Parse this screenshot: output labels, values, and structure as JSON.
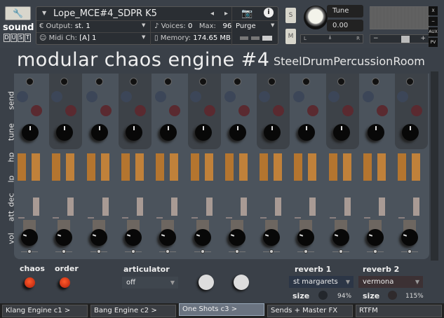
{
  "header": {
    "instrument_name": "Lope_MCE#4_SDPR K5",
    "output_label": "Output:",
    "output_value": "st. 1",
    "voices_label": "Voices:",
    "voices_value": "0",
    "max_label": "Max:",
    "max_value": "96",
    "purge_label": "Purge",
    "midi_label": "Midi Ch:",
    "midi_value": "[A] 1",
    "memory_label": "Memory:",
    "memory_value": "174.65 MB",
    "solo_label": "S",
    "mute_label": "M",
    "tune_label": "Tune",
    "tune_value": "0.00",
    "pan_left": "L",
    "pan_right": "R",
    "close_label": "X",
    "minimize_label": "−",
    "aux_label": "AUX",
    "pv_label": "PV",
    "vol_minus": "−",
    "vol_plus": "+"
  },
  "logo": {
    "word1": "sound",
    "letters": [
      "D",
      "U",
      "S",
      "T"
    ]
  },
  "title": "modular chaos engine #4",
  "subtitle": "SteelDrumPercussionRoom",
  "row_labels": {
    "send": "send",
    "tune": "tune",
    "hp": "hp",
    "lp": "lp",
    "dec": "dec",
    "att": "att",
    "vol": "vol"
  },
  "channel_count": 12,
  "controls": {
    "chaos": "chaos",
    "order": "order",
    "articulator": "articulator",
    "articulator_value": "off",
    "reverb1": "reverb 1",
    "reverb1_value": "st margarets",
    "reverb1_size_label": "size",
    "reverb1_size": "94%",
    "reverb2": "reverb 2",
    "reverb2_value": "vermona",
    "reverb2_size_label": "size",
    "reverb2_size": "115%"
  },
  "tabs": [
    {
      "label": "Klang Engine c1 >"
    },
    {
      "label": "Bang Engine c2 >"
    },
    {
      "label": "One Shots c3 >",
      "active": true
    },
    {
      "label": "Sends + Master FX"
    },
    {
      "label": "RTFM"
    }
  ],
  "colors": {
    "accent_orange": "#c0813a",
    "led_red": "#e03010",
    "send_blue": "#3c4658",
    "send_red": "#5a2a30"
  }
}
